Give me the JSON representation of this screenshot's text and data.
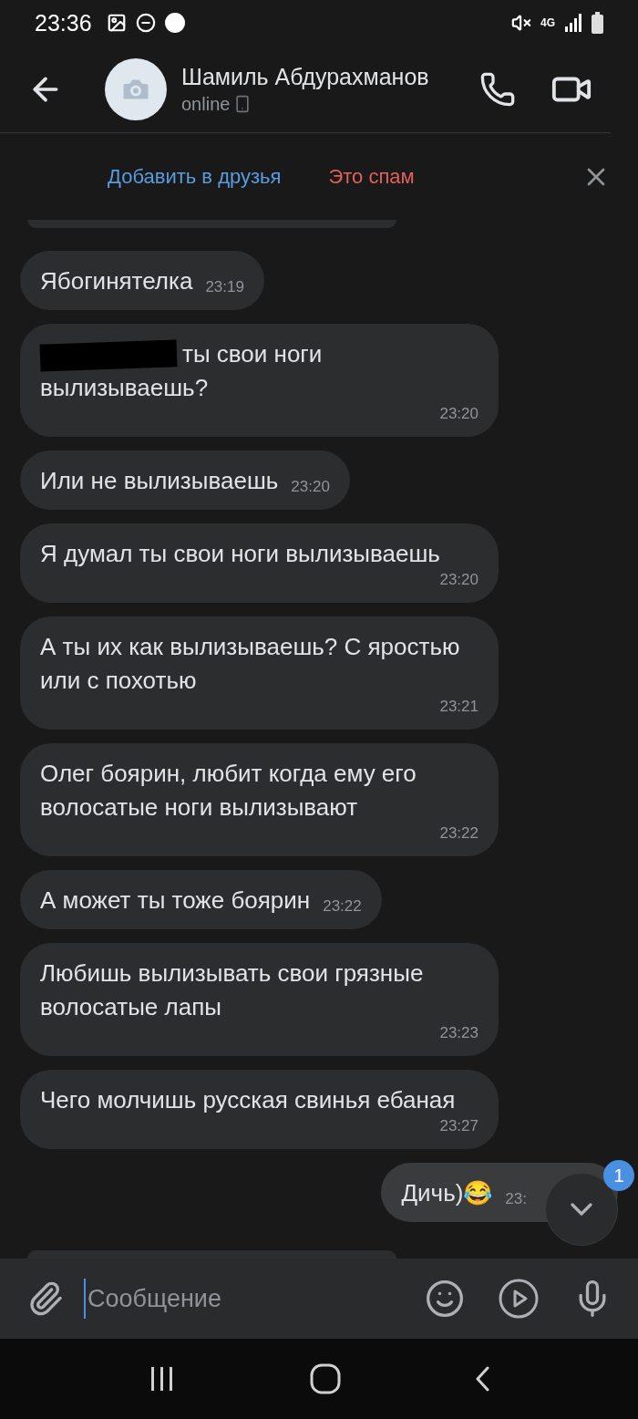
{
  "status_bar": {
    "time": "23:36",
    "network": "4G"
  },
  "header": {
    "name": "Шамиль Абдурахманов",
    "status": "online"
  },
  "request_bar": {
    "add_friend": "Добавить в друзья",
    "spam": "Это спам"
  },
  "messages": [
    {
      "kind": "cut"
    },
    {
      "kind": "incoming",
      "text": "Ябогинятелка",
      "time": "23:19",
      "redacted": false
    },
    {
      "kind": "incoming",
      "text": "ты свои ноги вылизываешь?",
      "time": "23:20",
      "redacted": true
    },
    {
      "kind": "incoming",
      "text": "Или не вылизываешь",
      "time": "23:20",
      "redacted": false
    },
    {
      "kind": "incoming",
      "text": "Я думал ты свои ноги вылизываешь",
      "time": "23:20",
      "redacted": false
    },
    {
      "kind": "incoming",
      "text": "А ты их как вылизываешь? С яростью или с похотью",
      "time": "23:21",
      "redacted": false
    },
    {
      "kind": "incoming",
      "text": "Олег боярин, любит когда ему его волосатые ноги вылизывают",
      "time": "23:22",
      "redacted": false
    },
    {
      "kind": "incoming",
      "text": "А может ты тоже боярин",
      "time": "23:22",
      "redacted": false
    },
    {
      "kind": "incoming",
      "text": "Любишь вылизывать свои грязные волосатые лапы",
      "time": "23:23",
      "redacted": false
    },
    {
      "kind": "incoming",
      "text": "Чего молчишь русская свинья ебаная",
      "time": "23:27",
      "redacted": false
    },
    {
      "kind": "outgoing",
      "text": "Дичь)😂",
      "time": "23:",
      "redacted": false
    },
    {
      "kind": "cut"
    }
  ],
  "scroll_button": {
    "badge": "1"
  },
  "composer": {
    "placeholder": "Сообщение"
  }
}
